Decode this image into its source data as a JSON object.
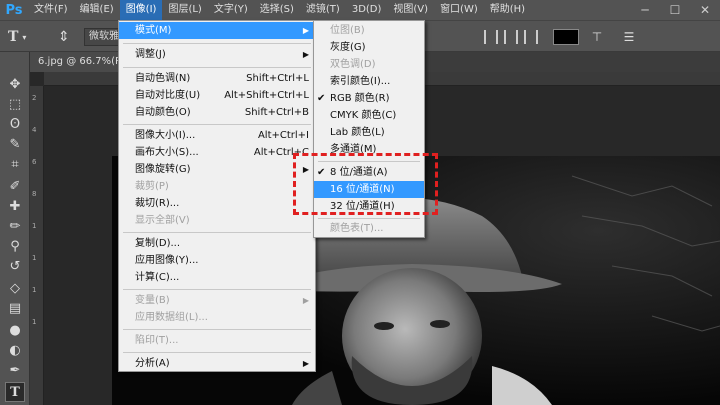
{
  "app": {
    "logo": "Ps"
  },
  "menubar": {
    "items": [
      "文件(F)",
      "编辑(E)",
      "图像(I)",
      "图层(L)",
      "文字(Y)",
      "选择(S)",
      "滤镜(T)",
      "3D(D)",
      "视图(V)",
      "窗口(W)",
      "帮助(H)"
    ],
    "active_index": 2
  },
  "options": {
    "font_family": "微软雅"
  },
  "document": {
    "tab_title": "6.jpg @ 66.7%(RG"
  },
  "rulers": {
    "left_numbers": [
      "2",
      "4",
      "6",
      "8",
      "1",
      "1",
      "1",
      "1"
    ]
  },
  "image_menu": {
    "items": [
      {
        "label": "模式(M)",
        "shortcut": "",
        "submenu": true,
        "disabled": false,
        "highlighted": true
      },
      {
        "label": "调整(J)",
        "shortcut": "",
        "submenu": true,
        "disabled": false
      },
      {
        "label": "自动色调(N)",
        "shortcut": "Shift+Ctrl+L",
        "submenu": false,
        "disabled": false
      },
      {
        "label": "自动对比度(U)",
        "shortcut": "Alt+Shift+Ctrl+L",
        "submenu": false,
        "disabled": false
      },
      {
        "label": "自动颜色(O)",
        "shortcut": "Shift+Ctrl+B",
        "submenu": false,
        "disabled": false
      },
      {
        "label": "图像大小(I)...",
        "shortcut": "Alt+Ctrl+I",
        "submenu": false,
        "disabled": false
      },
      {
        "label": "画布大小(S)...",
        "shortcut": "Alt+Ctrl+C",
        "submenu": false,
        "disabled": false
      },
      {
        "label": "图像旋转(G)",
        "shortcut": "",
        "submenu": true,
        "disabled": false
      },
      {
        "label": "裁剪(P)",
        "shortcut": "",
        "submenu": false,
        "disabled": true
      },
      {
        "label": "裁切(R)...",
        "shortcut": "",
        "submenu": false,
        "disabled": false
      },
      {
        "label": "显示全部(V)",
        "shortcut": "",
        "submenu": false,
        "disabled": true
      },
      {
        "label": "复制(D)...",
        "shortcut": "",
        "submenu": false,
        "disabled": false
      },
      {
        "label": "应用图像(Y)...",
        "shortcut": "",
        "submenu": false,
        "disabled": false
      },
      {
        "label": "计算(C)...",
        "shortcut": "",
        "submenu": false,
        "disabled": false
      },
      {
        "label": "变量(B)",
        "shortcut": "",
        "submenu": true,
        "disabled": true
      },
      {
        "label": "应用数据组(L)...",
        "shortcut": "",
        "submenu": false,
        "disabled": true
      },
      {
        "label": "陷印(T)...",
        "shortcut": "",
        "submenu": false,
        "disabled": true
      },
      {
        "label": "分析(A)",
        "shortcut": "",
        "submenu": true,
        "disabled": false
      }
    ]
  },
  "mode_menu": {
    "items": [
      {
        "label": "位图(B)",
        "checked": false,
        "disabled": true
      },
      {
        "label": "灰度(G)",
        "checked": false,
        "disabled": false
      },
      {
        "label": "双色调(D)",
        "checked": false,
        "disabled": true
      },
      {
        "label": "索引颜色(I)...",
        "checked": false,
        "disabled": false
      },
      {
        "label": "RGB 颜色(R)",
        "checked": true,
        "disabled": false
      },
      {
        "label": "CMYK 颜色(C)",
        "checked": false,
        "disabled": false
      },
      {
        "label": "Lab 颜色(L)",
        "checked": false,
        "disabled": false
      },
      {
        "label": "多通道(M)",
        "checked": false,
        "disabled": false
      },
      {
        "label": "8 位/通道(A)",
        "checked": true,
        "disabled": false
      },
      {
        "label": "16 位/通道(N)",
        "checked": false,
        "disabled": false,
        "highlighted": true
      },
      {
        "label": "32 位/通道(H)",
        "checked": false,
        "disabled": false
      },
      {
        "label": "颜色表(T)...",
        "checked": false,
        "disabled": true
      }
    ]
  },
  "glyphs": {
    "check": "✔",
    "arrow": "▶"
  },
  "colors": {
    "menu_highlight": "#3399ff",
    "annotation": "#e02020",
    "ps_blue": "#31a8ff"
  }
}
